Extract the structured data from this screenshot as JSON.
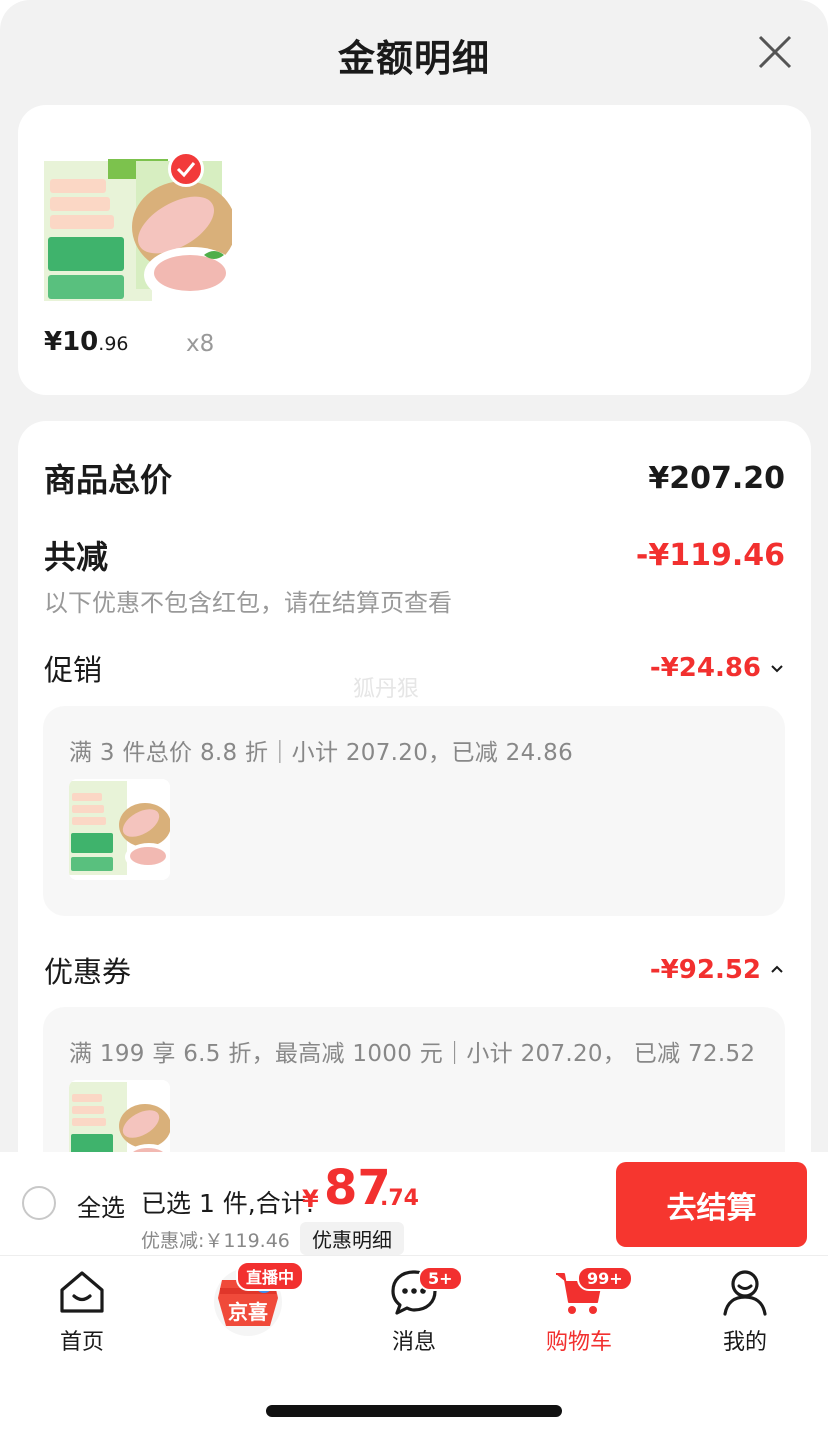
{
  "sheet": {
    "title": "金额明细"
  },
  "product": {
    "price_int": "¥10",
    "price_dec": ".96",
    "quantity": "x8"
  },
  "summary": {
    "total_label": "商品总价",
    "total_value": "¥207.20",
    "reduction_label": "共减",
    "reduction_value": "-¥119.46",
    "note": "以下优惠不包含红包，请在结算页查看"
  },
  "watermark": "狐丹狠",
  "promotion": {
    "label": "促销",
    "value": "-¥24.86",
    "detail": "满 3 件总价 8.8 折｜小计 207.20，已减 24.86"
  },
  "coupon": {
    "label": "优惠券",
    "value": "-¥92.52",
    "detail": "满 199 享 6.5 折，最高减 1000 元｜小计 207.20， 已减 72.52"
  },
  "bottom_bar": {
    "select_all": "全选",
    "selected_info": "已选 1 件,合计:",
    "total_yen": "¥",
    "total_int": "87",
    "total_dec": ".74",
    "discount": "优惠减:￥119.46",
    "detail_chip": "优惠明细",
    "checkout": "去结算"
  },
  "tabs": [
    {
      "label": "首页",
      "icon": "home-icon"
    },
    {
      "label": "京喜",
      "icon": "jingxi-icon",
      "badge": "直播中"
    },
    {
      "label": "消息",
      "icon": "message-icon",
      "badge": "5+"
    },
    {
      "label": "购物车",
      "icon": "cart-icon",
      "badge": "99+"
    },
    {
      "label": "我的",
      "icon": "profile-icon"
    }
  ],
  "colors": {
    "accent": "#f2302f",
    "background": "#f2f2f2"
  }
}
